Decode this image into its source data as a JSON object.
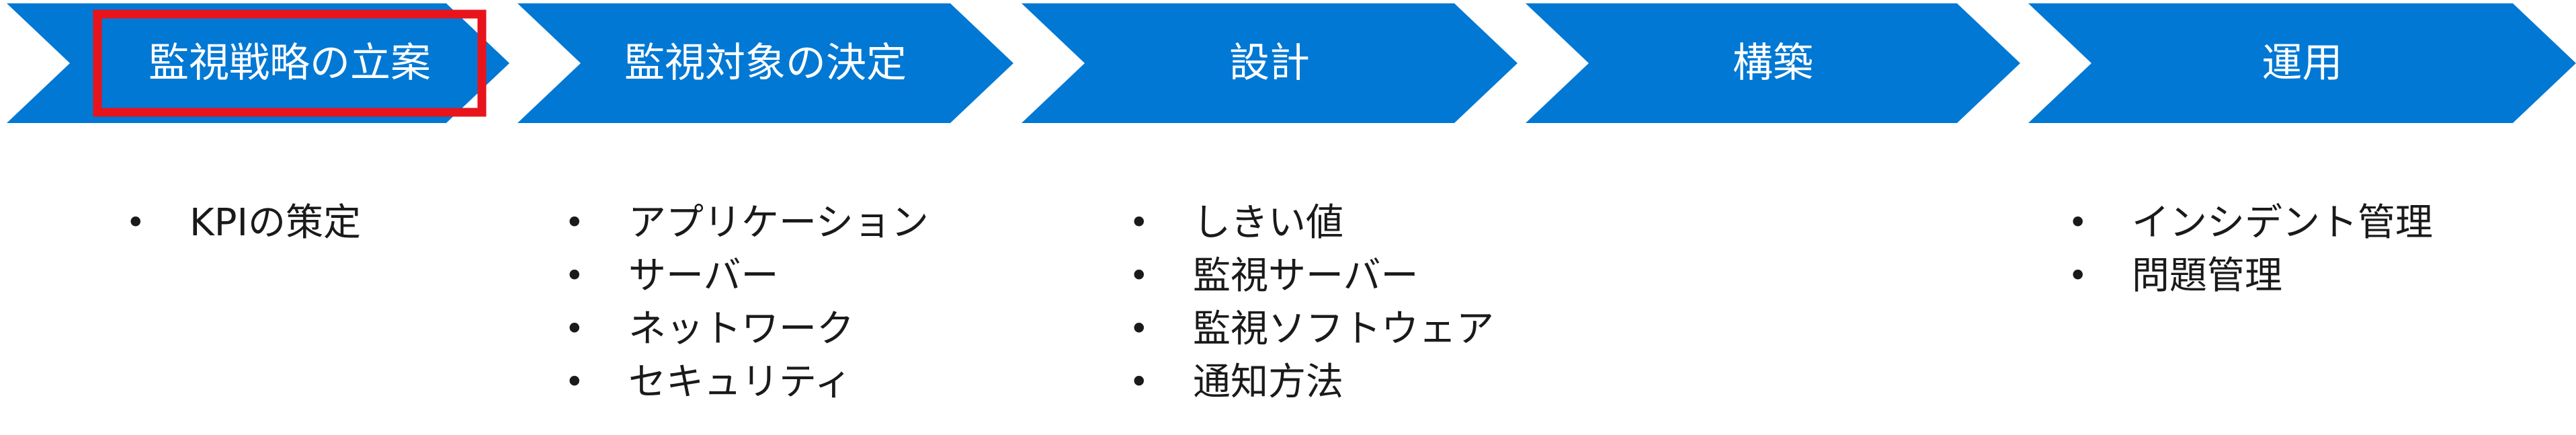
{
  "process": {
    "highlighted_index": 0,
    "colors": {
      "chevron_fill": "#0078d4",
      "chevron_text": "#ffffff",
      "highlight_border": "#e8141c",
      "body_text": "#1a1a1a"
    },
    "stages": [
      {
        "label": "監視戦略の立案",
        "items": [
          "KPIの策定"
        ]
      },
      {
        "label": "監視対象の決定",
        "items": [
          "アプリケーション",
          "サーバー",
          "ネットワーク",
          "セキュリティ"
        ]
      },
      {
        "label": "設計",
        "items": [
          "しきい値",
          "監視サーバー",
          "監視ソフトウェア",
          "通知方法"
        ]
      },
      {
        "label": "構築",
        "items": []
      },
      {
        "label": "運用",
        "items": [
          "インシデント管理",
          "問題管理"
        ]
      }
    ]
  },
  "bullet_glyph": "•"
}
